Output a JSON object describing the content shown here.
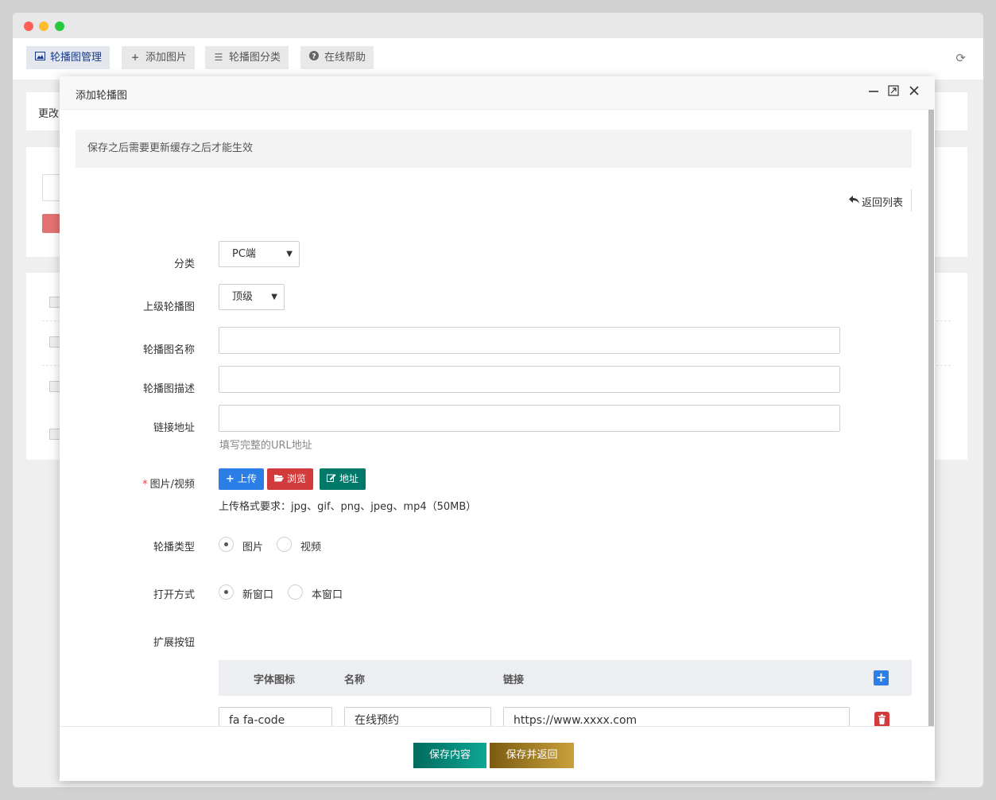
{
  "toolbar": {
    "tabs": [
      {
        "label": "轮播图管理",
        "icon": "image-icon"
      },
      {
        "label": "添加图片",
        "icon": "plus-icon"
      },
      {
        "label": "轮播图分类",
        "icon": "list-icon"
      },
      {
        "label": "在线帮助",
        "icon": "question-circle-icon"
      }
    ]
  },
  "background": {
    "card1_text": "更改"
  },
  "modal": {
    "title": "添加轮播图",
    "notice": "保存之后需要更新缓存之后才能生效",
    "back_link": "返回列表",
    "fields": {
      "category_label": "分类",
      "category_value": "PC端",
      "parent_label": "上级轮播图",
      "parent_value": "顶级",
      "name_label": "轮播图名称",
      "desc_label": "轮播图描述",
      "link_label": "链接地址",
      "link_help": "填写完整的URL地址",
      "media_label": "图片/视频",
      "media_required_mark": "*",
      "upload_btn": "上传",
      "browse_btn": "浏览",
      "address_btn": "地址",
      "media_format": "上传格式要求：jpg、gif、png、jpeg、mp4（50MB）",
      "type_label": "轮播类型",
      "type_options": [
        "图片",
        "视频"
      ],
      "open_label": "打开方式",
      "open_options": [
        "新窗口",
        "本窗口"
      ],
      "ext_label": "扩展按钮"
    },
    "ext_table": {
      "headers": [
        "字体图标",
        "名称",
        "链接"
      ],
      "rows": [
        {
          "icon": "fa fa-code",
          "name": "在线预约",
          "link": "https://www.xxxx.com"
        }
      ]
    },
    "footer": {
      "save": "保存内容",
      "save_back": "保存并返回"
    }
  }
}
